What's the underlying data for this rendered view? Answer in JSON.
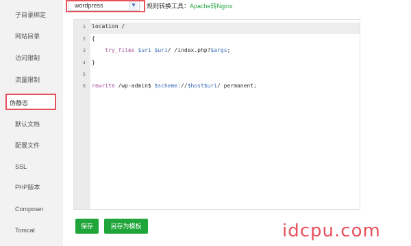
{
  "sidebar": {
    "items": [
      {
        "label": "子目录绑定"
      },
      {
        "label": "网站目录"
      },
      {
        "label": "访问限制"
      },
      {
        "label": "流量限制"
      },
      {
        "label": "伪静态",
        "active": true
      },
      {
        "label": "默认文档"
      },
      {
        "label": "配置文件"
      },
      {
        "label": "SSL"
      },
      {
        "label": "PHP版本"
      },
      {
        "label": "Composer"
      },
      {
        "label": "Tomcat"
      }
    ]
  },
  "toolbar": {
    "rule_select_value": "wordpress",
    "hint_prefix": "规则转换工具：",
    "hint_link": "Apache转Nginx"
  },
  "editor": {
    "line_numbers": [
      "1",
      "2",
      "3",
      "4",
      "5",
      "6"
    ],
    "lines": {
      "l1": "location /",
      "l2": "{",
      "l3_a": "    try_files ",
      "l3_b": "$uri",
      "l3_c": " ",
      "l3_d": "$uri",
      "l3_e": "/ /index.php?",
      "l3_f": "$args",
      "l3_g": ";",
      "l4": "}",
      "l5": "",
      "l6_a": "rewrite",
      "l6_b": " /wp-admin$ ",
      "l6_c": "$scheme",
      "l6_d": "://",
      "l6_e": "$host",
      "l6_f": "$uri",
      "l6_g": "/ permanent;"
    }
  },
  "buttons": {
    "save": "保存",
    "save_as_template": "另存为模板"
  },
  "watermark": "idcpu.com",
  "colors": {
    "accent_red": "#e8505b",
    "button_green": "#20a53a",
    "link_green": "#2ba84a"
  }
}
